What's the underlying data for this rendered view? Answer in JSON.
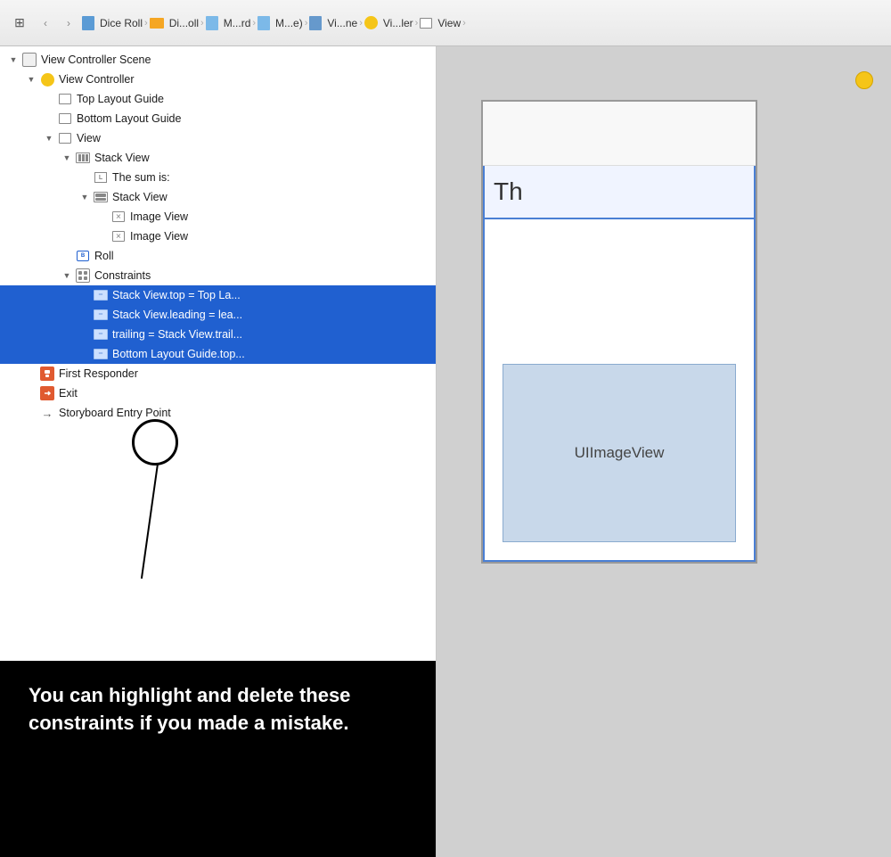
{
  "toolbar": {
    "nav_back": "‹",
    "nav_forward": "›",
    "breadcrumb": [
      {
        "label": "Dice Roll",
        "icon": "doc"
      },
      {
        "label": "Di...oll",
        "icon": "folder"
      },
      {
        "label": "M...rd",
        "icon": "doc"
      },
      {
        "label": "M...e)",
        "icon": "doc"
      },
      {
        "label": "Vi...ne",
        "icon": "storyboard"
      },
      {
        "label": "Vi...ler",
        "icon": "vc"
      },
      {
        "label": "View",
        "icon": "view"
      }
    ],
    "end_chevron": "›"
  },
  "outline": {
    "items": [
      {
        "id": "vc-scene",
        "indent": 1,
        "disclosure": "open",
        "icon": "vc-scene",
        "label": "View Controller Scene"
      },
      {
        "id": "vc",
        "indent": 2,
        "disclosure": "open",
        "icon": "vc",
        "label": "View Controller"
      },
      {
        "id": "top-layout-guide",
        "indent": 3,
        "disclosure": "none",
        "icon": "layout-guide",
        "label": "Top Layout Guide"
      },
      {
        "id": "bottom-layout-guide",
        "indent": 3,
        "disclosure": "none",
        "icon": "layout-guide",
        "label": "Bottom Layout Guide"
      },
      {
        "id": "view",
        "indent": 3,
        "disclosure": "open",
        "icon": "view",
        "label": "View"
      },
      {
        "id": "stack-view-outer",
        "indent": 4,
        "disclosure": "open",
        "icon": "stack-view",
        "label": "Stack View"
      },
      {
        "id": "label-sum",
        "indent": 5,
        "disclosure": "none",
        "icon": "label",
        "label": "The sum is:"
      },
      {
        "id": "stack-view-inner",
        "indent": 5,
        "disclosure": "open",
        "icon": "stack-view-v",
        "label": "Stack View"
      },
      {
        "id": "image-view-1",
        "indent": 6,
        "disclosure": "none",
        "icon": "image-view",
        "label": "Image View"
      },
      {
        "id": "image-view-2",
        "indent": 6,
        "disclosure": "none",
        "icon": "image-view",
        "label": "Image View"
      },
      {
        "id": "button-roll",
        "indent": 4,
        "disclosure": "none",
        "icon": "button",
        "label": "Roll"
      },
      {
        "id": "constraints",
        "indent": 4,
        "disclosure": "open",
        "icon": "constraints",
        "label": "Constraints"
      },
      {
        "id": "constraint-1",
        "indent": 5,
        "disclosure": "none",
        "icon": "constraint",
        "label": "Stack View.top = Top La...",
        "selected": true
      },
      {
        "id": "constraint-2",
        "indent": 5,
        "disclosure": "none",
        "icon": "constraint",
        "label": "Stack View.leading = lea...",
        "selected": true
      },
      {
        "id": "constraint-3",
        "indent": 5,
        "disclosure": "none",
        "icon": "constraint",
        "label": "trailing = Stack View.trail...",
        "selected": true
      },
      {
        "id": "constraint-4",
        "indent": 5,
        "disclosure": "none",
        "icon": "constraint",
        "label": "Bottom Layout Guide.top...",
        "selected": true
      },
      {
        "id": "first-responder",
        "indent": 2,
        "disclosure": "none",
        "icon": "first-responder",
        "label": "First Responder"
      },
      {
        "id": "exit",
        "indent": 2,
        "disclosure": "none",
        "icon": "exit",
        "label": "Exit"
      },
      {
        "id": "storyboard-entry",
        "indent": 2,
        "disclosure": "none",
        "icon": "storyboard-entry",
        "label": "Storyboard Entry Point"
      }
    ]
  },
  "canvas": {
    "phone_text": "Th",
    "ui_image_view_label": "UIImageView"
  },
  "annotation": {
    "text": "You can highlight and delete these constraints if you made a mistake."
  }
}
